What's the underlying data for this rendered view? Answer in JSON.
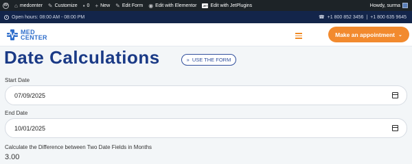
{
  "adminbar": {
    "site": "medcenter",
    "customize": "Customize",
    "comments": "0",
    "new": "New",
    "edit_form": "Edit Form",
    "edit_elementor": "Edit with Elementor",
    "edit_jet": "Edit with JetPlugins",
    "greeting": "Howdy, surma"
  },
  "topbar": {
    "hours": "Open hours: 08:00 AM - 08:00 PM",
    "phone1": "+1 800 852 3456",
    "separator": "|",
    "phone2": "+1 800 635 9645"
  },
  "header": {
    "logo_line1": "MED",
    "logo_line2": "CENTER",
    "cta_label": "Make an appointment"
  },
  "main": {
    "title": "Date Calculations",
    "use_form": "USE THE FORM",
    "start_label": "Start Date",
    "start_value": "07/09/2025",
    "end_label": "End Date",
    "end_value": "10/01/2025",
    "calc_label": "Calculate the Difference between Two Date Fields in Months",
    "calc_value": "3.00"
  },
  "colors": {
    "accent": "#f28a2e",
    "brand": "#1a3a86",
    "topbar": "#13254a",
    "adminbar": "#1d2327"
  }
}
